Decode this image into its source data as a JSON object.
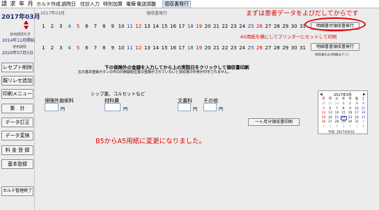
{
  "menubar": {
    "app_title": "請 求 年 月",
    "items": [
      "カルテ作成",
      "過院日",
      "往診入力",
      "特別加算",
      "電療",
      "電送調整",
      "領収書発行"
    ]
  },
  "sidebar": {
    "year_month": "2017年03月",
    "license_label": "使用期限年月",
    "license_value": "2014年11月開始",
    "period_label": "使用期限",
    "period_value": "2020年07月5日",
    "buttons": [
      "レセプト削除",
      "親リレセ追加",
      "印刷メニュー",
      "集　計",
      "データ訂正",
      "データ変換",
      "料 金 登 録",
      "基本登録"
    ],
    "bottom_button": "カルテ管理終了"
  },
  "header": {
    "current_month": "2017年03月",
    "section_title": "領収書発行"
  },
  "annotations": {
    "top_note": "まずは患者データをよびだしてからです",
    "a5_note": "A5用紙を横にしてプリンターにセットして印刷",
    "bottom_note": "B5からA5用紙に変更になりました。"
  },
  "days_row1": [
    "1",
    "2",
    "3",
    "4",
    "5",
    "6",
    "7",
    "8",
    "9",
    "10",
    "11",
    "12",
    "13",
    "14",
    "15",
    "16",
    "17",
    "18",
    "19",
    "20",
    "21",
    "22",
    "23",
    "24",
    "25",
    "26",
    "27",
    "28",
    "29",
    "30",
    "31"
  ],
  "days_row2": [
    "1",
    "2",
    "3",
    "4",
    "5",
    "6",
    "7",
    "8",
    "9",
    "10",
    "11",
    "12",
    "13",
    "14",
    "15",
    "16",
    "17",
    "18",
    "19",
    "20",
    "21",
    "22",
    "23",
    "24",
    "25",
    "26",
    "27",
    "28",
    "29",
    "30",
    "31"
  ],
  "day_colors": {
    "sun": "#d40000",
    "sat": "#1c3fb8"
  },
  "right_buttons": {
    "issue_with_details": "明細書付領収書発行",
    "issue_details_receipt": "明細書書領収書発行",
    "details_sublabel": "領収書のみ(明細はナシ)"
  },
  "instructions": {
    "line1": "下の保険外の金額を入力してから上の実院日をクリックして領収書印刷",
    "line2": "左の基本登録ボタンの中の印刷開始位置の登録がされていないと領収書の中身が印字されません。"
  },
  "form": {
    "note_label": "シップ薬、コルセットなど",
    "fields": [
      {
        "label": "保険外施術料",
        "value": "",
        "unit": "円"
      },
      {
        "label": "材料費",
        "value": "",
        "unit": "円"
      },
      {
        "label": "文書料",
        "value": "",
        "unit": "円"
      },
      {
        "label": "その他",
        "value": "",
        "unit": "円"
      }
    ],
    "monthly_button": "一ヶ月分領収書印刷"
  },
  "calendar": {
    "title": "2017年3月",
    "weekdays": [
      "日",
      "月",
      "火",
      "水",
      "木",
      "金",
      "土"
    ],
    "cells": [
      "26",
      "27",
      "28",
      "1",
      "2",
      "3",
      "4",
      "5",
      "6",
      "7",
      "8",
      "9",
      "10",
      "11",
      "12",
      "13",
      "14",
      "15",
      "16",
      "17",
      "18",
      "19",
      "20",
      "21",
      "22",
      "23",
      "24",
      "25",
      "26",
      "27",
      "28",
      "29",
      "30",
      "31",
      "1",
      "2",
      "3",
      "4",
      "5",
      "6",
      "7",
      "8"
    ],
    "today": "今日: 2017/03/22"
  }
}
